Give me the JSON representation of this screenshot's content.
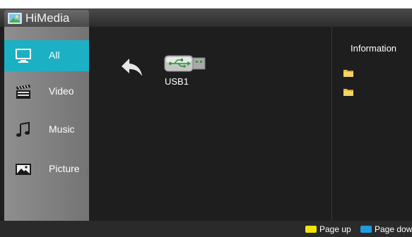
{
  "app": {
    "title": "HiMedia",
    "logo_icon": "picture-icon"
  },
  "sidebar": {
    "items": [
      {
        "label": "All",
        "icon": "monitor-icon",
        "active": true
      },
      {
        "label": "Video",
        "icon": "clapperboard-icon",
        "active": false
      },
      {
        "label": "Music",
        "icon": "music-note-icon",
        "active": false
      },
      {
        "label": "Picture",
        "icon": "picture-icon",
        "active": false
      }
    ]
  },
  "browser": {
    "back_icon": "back-arrow-icon",
    "devices": [
      {
        "label": "USB1",
        "icon": "usb-drive-icon"
      }
    ]
  },
  "info": {
    "title": "Information",
    "icons": [
      "folder-icon",
      "folder-icon"
    ]
  },
  "footer": {
    "page_up_label": "Page up",
    "page_down_label": "Page dow",
    "page_up_color": "#f4e20b",
    "page_down_color": "#1f9be0"
  },
  "colors": {
    "accent": "#1cb0c4"
  }
}
